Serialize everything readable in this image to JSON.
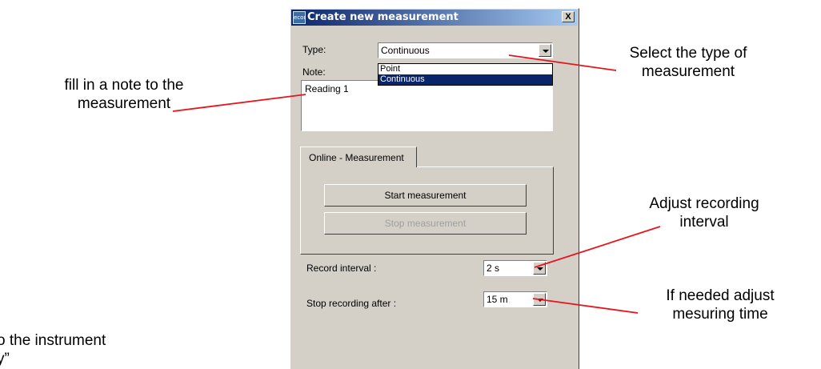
{
  "annotations": {
    "note": [
      "fill in a note to the",
      "measurement"
    ],
    "type": [
      "Select the type of",
      "measurement"
    ],
    "interval": [
      "Adjust recording",
      "interval"
    ],
    "time": [
      "If needed adjust",
      "mesuring time"
    ],
    "bottom_left": [
      "o the instrument",
      "y”"
    ]
  },
  "dialog": {
    "title": "Create new measurement",
    "icon_text": "econ",
    "close_label": "X",
    "type_label": "Type:",
    "type_value": "Continuous",
    "type_options": [
      "Point",
      "Continuous"
    ],
    "type_selected_index": 1,
    "note_label": "Note:",
    "note_value": "Reading 1",
    "tab_label": "Online - Measurement",
    "start_button": "Start measurement",
    "stop_button": "Stop measurement",
    "record_interval_label": "Record interval :",
    "record_interval_value": "2 s",
    "stop_after_label": "Stop recording after :",
    "stop_after_value": "15 m"
  },
  "colors": {
    "annotation_line": "#e8141c",
    "selection": "#0a246a",
    "title_bar": "#0a246a",
    "dialog_bg": "#d4d0c8"
  }
}
